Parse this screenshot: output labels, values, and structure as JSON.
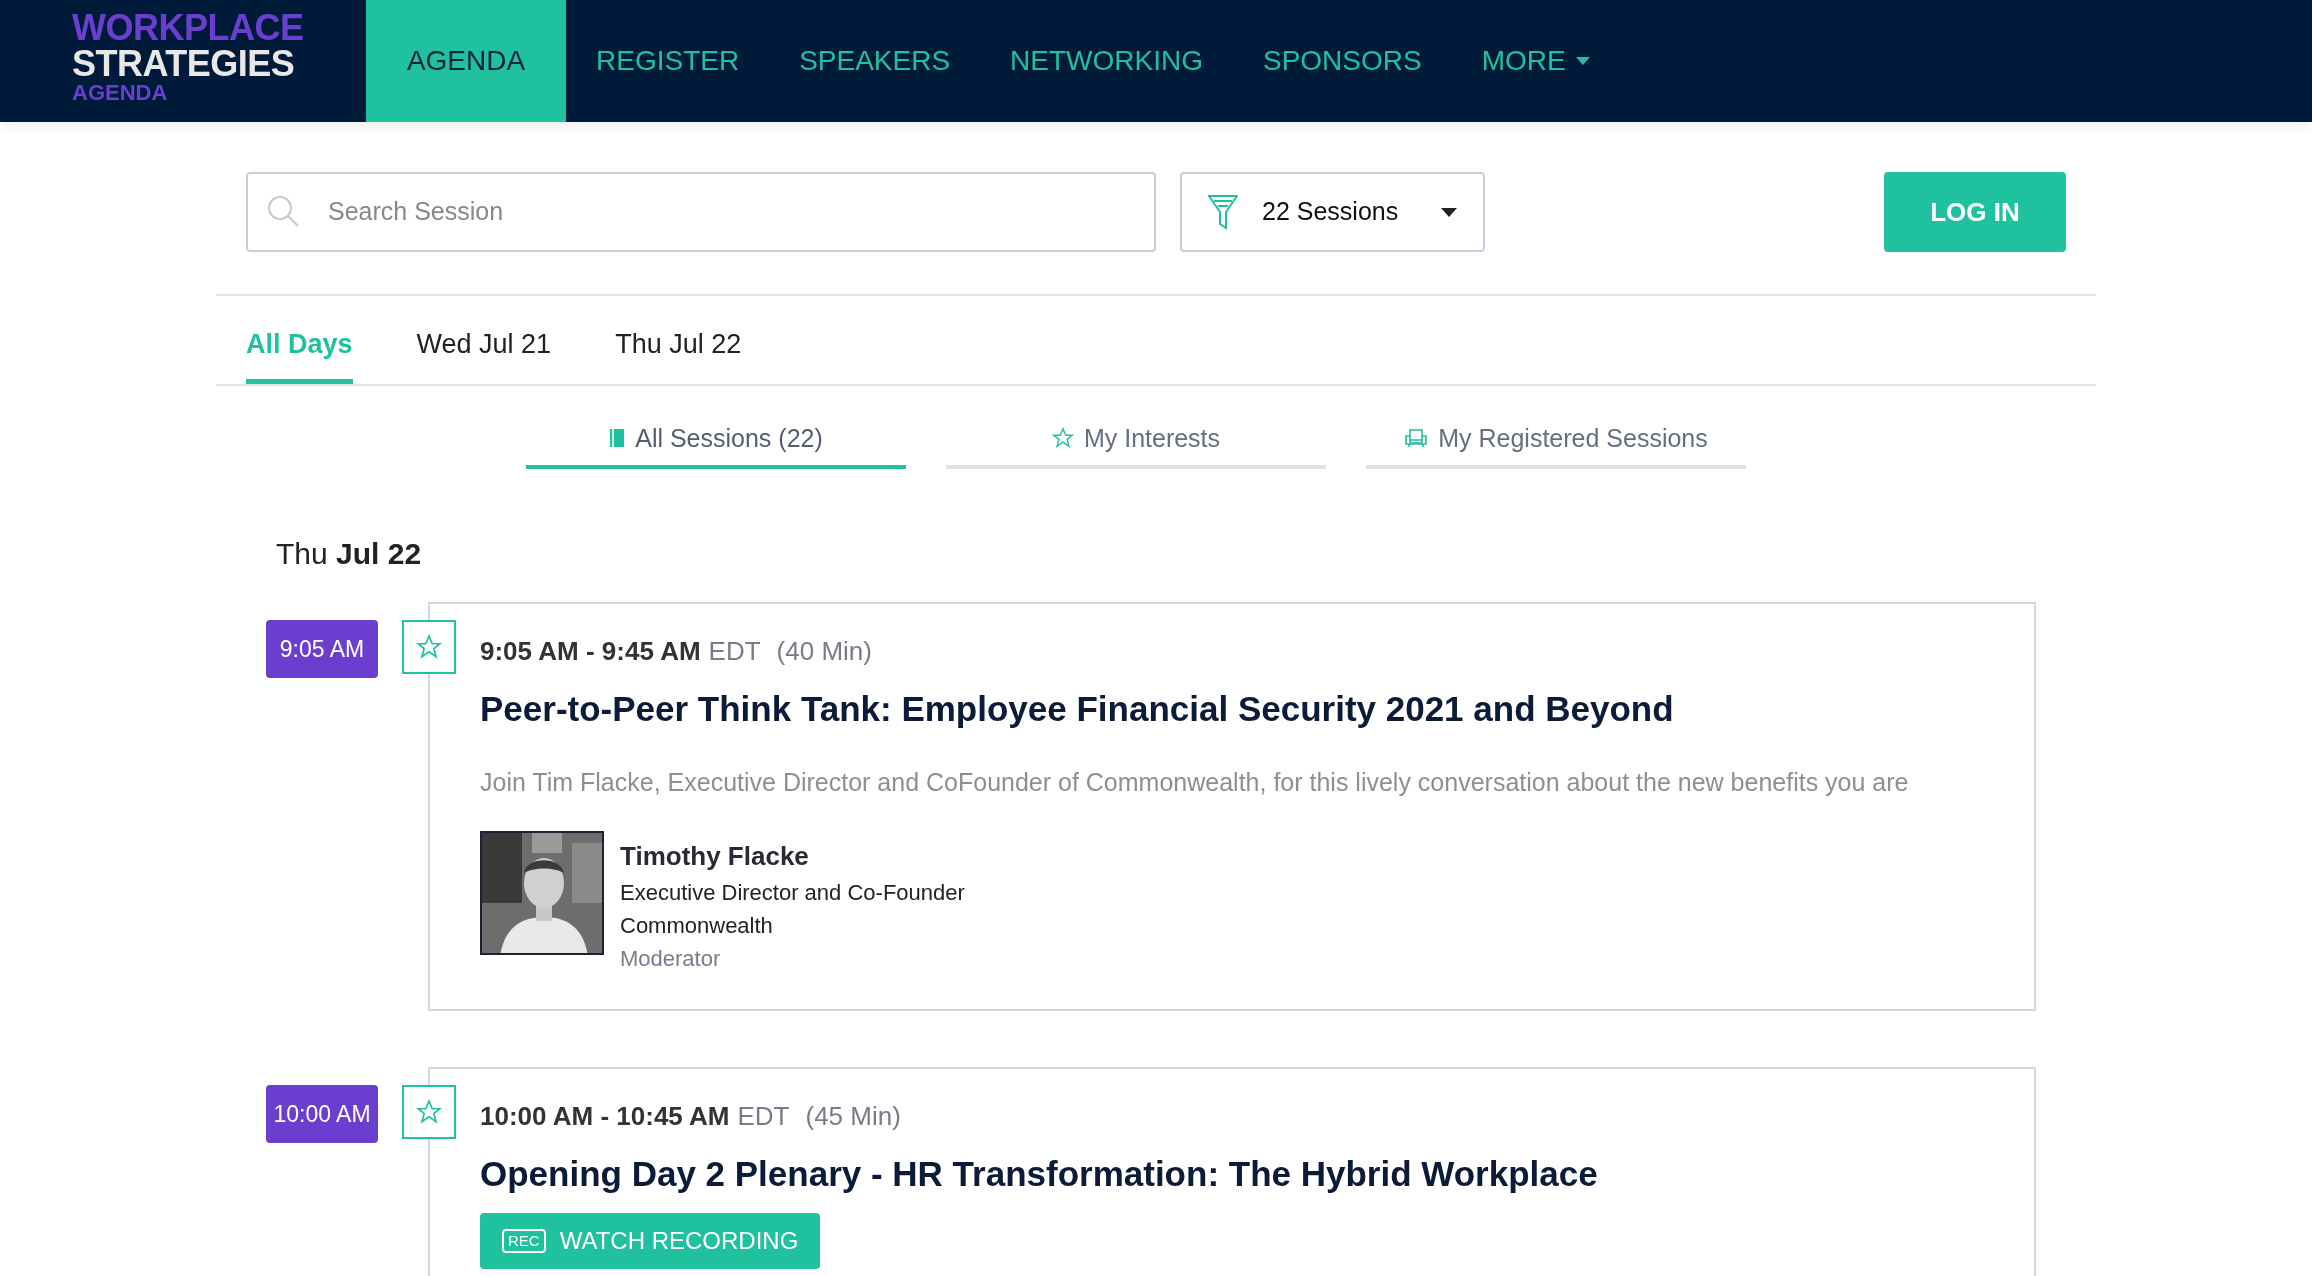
{
  "logo": {
    "line_1": "WORKPLACE",
    "line_2": "STRATEGIES",
    "line_3": "AGENDA"
  },
  "nav": [
    {
      "label": "AGENDA",
      "selected": true
    },
    {
      "label": "REGISTER",
      "selected": false
    },
    {
      "label": "SPEAKERS",
      "selected": false
    },
    {
      "label": "NETWORKING",
      "selected": false
    },
    {
      "label": "SPONSORS",
      "selected": false
    },
    {
      "label": "MORE",
      "selected": false,
      "dropdown": true
    }
  ],
  "search": {
    "placeholder": "Search Session"
  },
  "filter": {
    "label": "22 Sessions"
  },
  "login_button": "LOG IN",
  "day_tabs": [
    {
      "label": "All Days",
      "selected": true
    },
    {
      "label": "Wed Jul 21",
      "selected": false
    },
    {
      "label": "Thu Jul 22",
      "selected": false
    }
  ],
  "session_tabs": [
    {
      "label": "All Sessions (22)",
      "selected": true
    },
    {
      "label": "My Interests",
      "selected": false
    },
    {
      "label": "My Registered Sessions",
      "selected": false
    }
  ],
  "date_heading": "Thu **Jul 22**",
  "sessions": [
    {
      "badge": "9:05 AM",
      "starred": false,
      "time": "9:05 AM - 9:45 AM",
      "timezone": "EDT",
      "duration": "(40 Min)",
      "title": "Peer-to-Peer Think Tank: Employee Financial Security 2021 and Beyond",
      "description": "Join Tim Flacke, Executive Director and CoFounder of Commonwealth, for this lively conversation about the new benefits you are",
      "speakers": [
        {
          "kind": "picture",
          "name": "Timothy Flacke",
          "job": "Executive Director and Co-Founder",
          "company": "Commonwealth",
          "role": "Moderator"
        }
      ]
    },
    {
      "badge": "10:00 AM",
      "starred": false,
      "time": "10:00 AM - 10:45 AM",
      "timezone": "EDT",
      "duration": "(45 Min)",
      "title": "Opening Day 2 Plenary - HR Transformation: The Hybrid Workplace",
      "recording": {
        "icon_text": "REC",
        "label": "WATCH RECORDING"
      }
    }
  ]
}
